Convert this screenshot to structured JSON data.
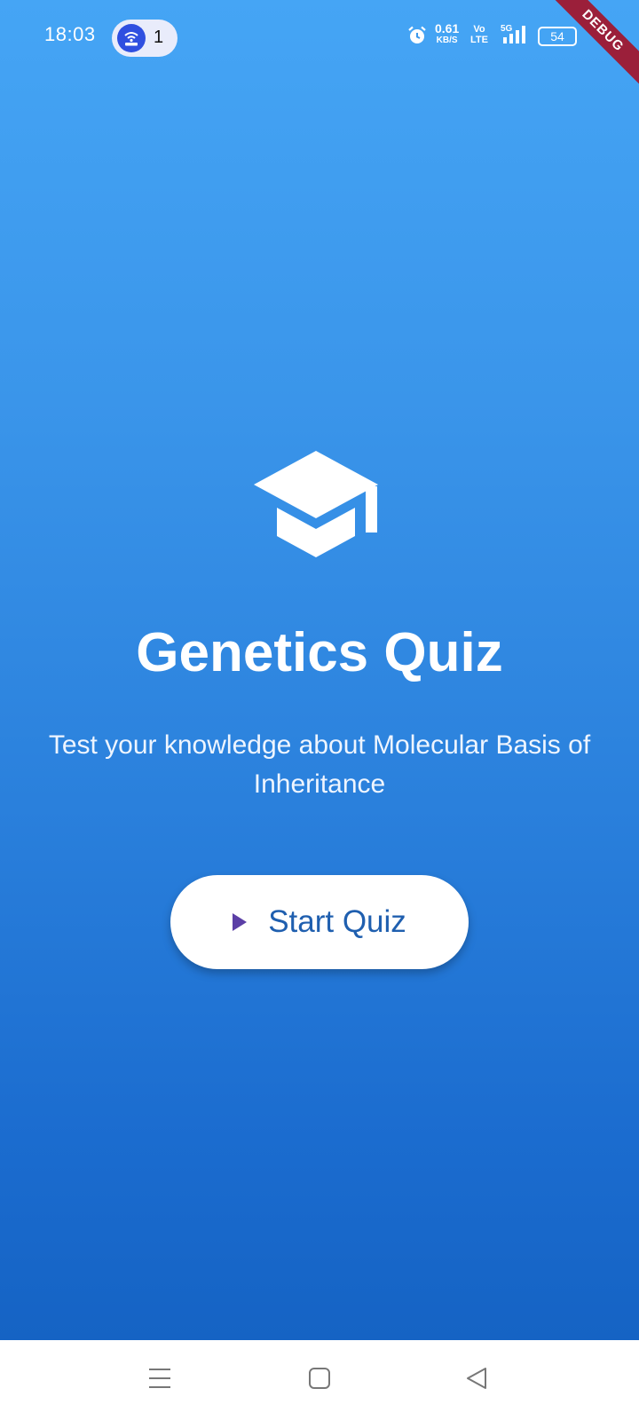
{
  "status_bar": {
    "time": "18:03",
    "notification_count": "1",
    "net_speed": "0.61",
    "net_unit": "KB/S",
    "volte_top": "Vo",
    "volte_bottom": "LTE",
    "network": "5G",
    "battery": "54",
    "debug_banner": "DEBUG"
  },
  "main": {
    "icon": "graduation-cap-icon",
    "title": "Genetics Quiz",
    "subtitle": "Test your knowledge about Molecular Basis of Inheritance",
    "start_button": {
      "label": "Start Quiz",
      "icon": "play-icon"
    }
  },
  "nav_bar": {
    "items": [
      "menu-icon",
      "home-icon",
      "back-icon"
    ]
  },
  "colors": {
    "gradient_top": "#45a5f5",
    "gradient_bottom": "#1563c4",
    "button_text": "#1f5faf",
    "play_icon": "#5b3fa6",
    "debug_ribbon": "#9b1f3a"
  }
}
